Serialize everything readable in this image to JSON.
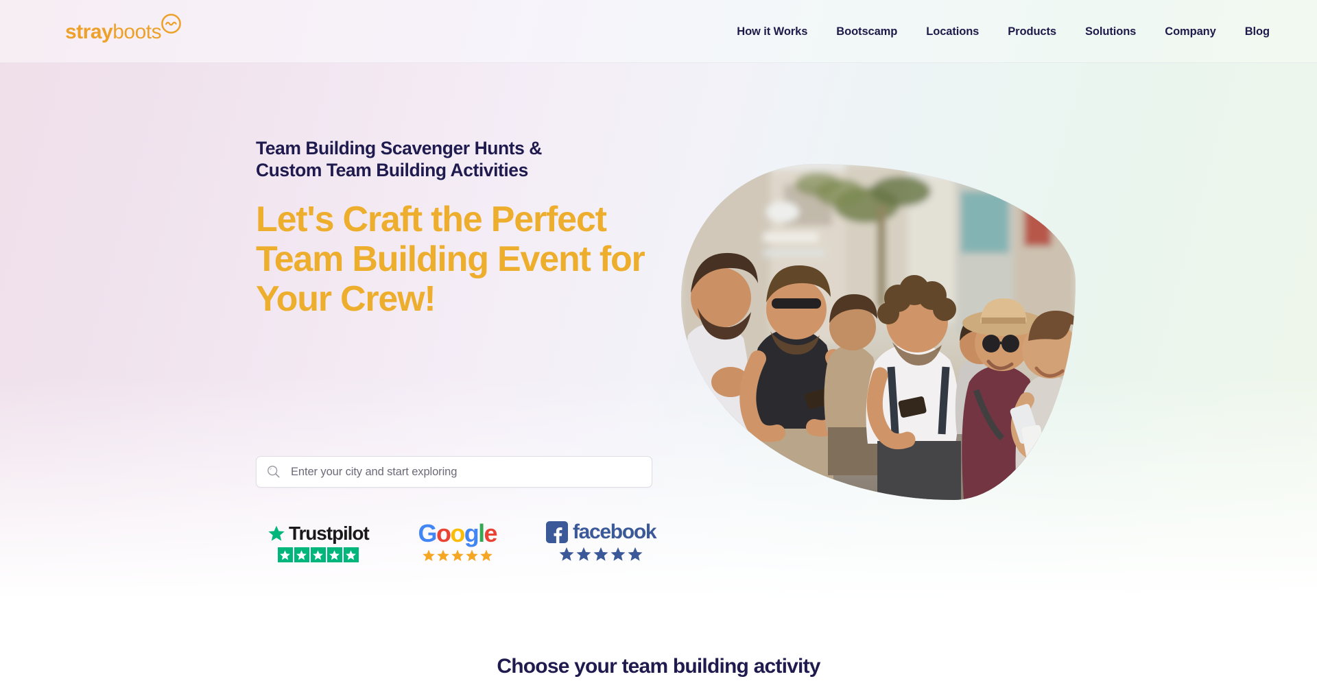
{
  "brand": {
    "name_bold": "stray",
    "name_light": "boots",
    "mark": "circle-tilde-icon",
    "accent_color": "#eda12a"
  },
  "nav": {
    "items": [
      {
        "label": "How it Works"
      },
      {
        "label": "Bootscamp"
      },
      {
        "label": "Locations"
      },
      {
        "label": "Products"
      },
      {
        "label": "Solutions"
      },
      {
        "label": "Company"
      },
      {
        "label": "Blog"
      }
    ]
  },
  "hero": {
    "eyebrow_line1": "Team Building Scavenger Hunts &",
    "eyebrow_line2": "Custom Team Building Activities",
    "headline_line1": "Let's Craft the Perfect",
    "headline_line2": "Team Building Event for",
    "headline_line3": "Your Crew!",
    "headline_color": "#eeae2d",
    "eyebrow_color": "#201b4e",
    "image_alt": "group-of-travelers-with-phones-photo"
  },
  "search": {
    "placeholder": "Enter your city and start exploring",
    "value": "",
    "icon": "search-icon"
  },
  "badges": [
    {
      "id": "trustpilot",
      "name": "Trustpilot",
      "stars": 5,
      "star_color": "#00b67a",
      "logo_icon": "trustpilot-star-icon"
    },
    {
      "id": "google",
      "name": "Google",
      "letters": [
        "G",
        "o",
        "o",
        "g",
        "l",
        "e"
      ],
      "stars": 5,
      "star_color": "#f5a623"
    },
    {
      "id": "facebook",
      "name": "facebook",
      "stars": 5,
      "star_color": "#3b5998",
      "logo_icon": "facebook-f-icon"
    }
  ],
  "next_section": {
    "title": "Choose your team building activity"
  }
}
